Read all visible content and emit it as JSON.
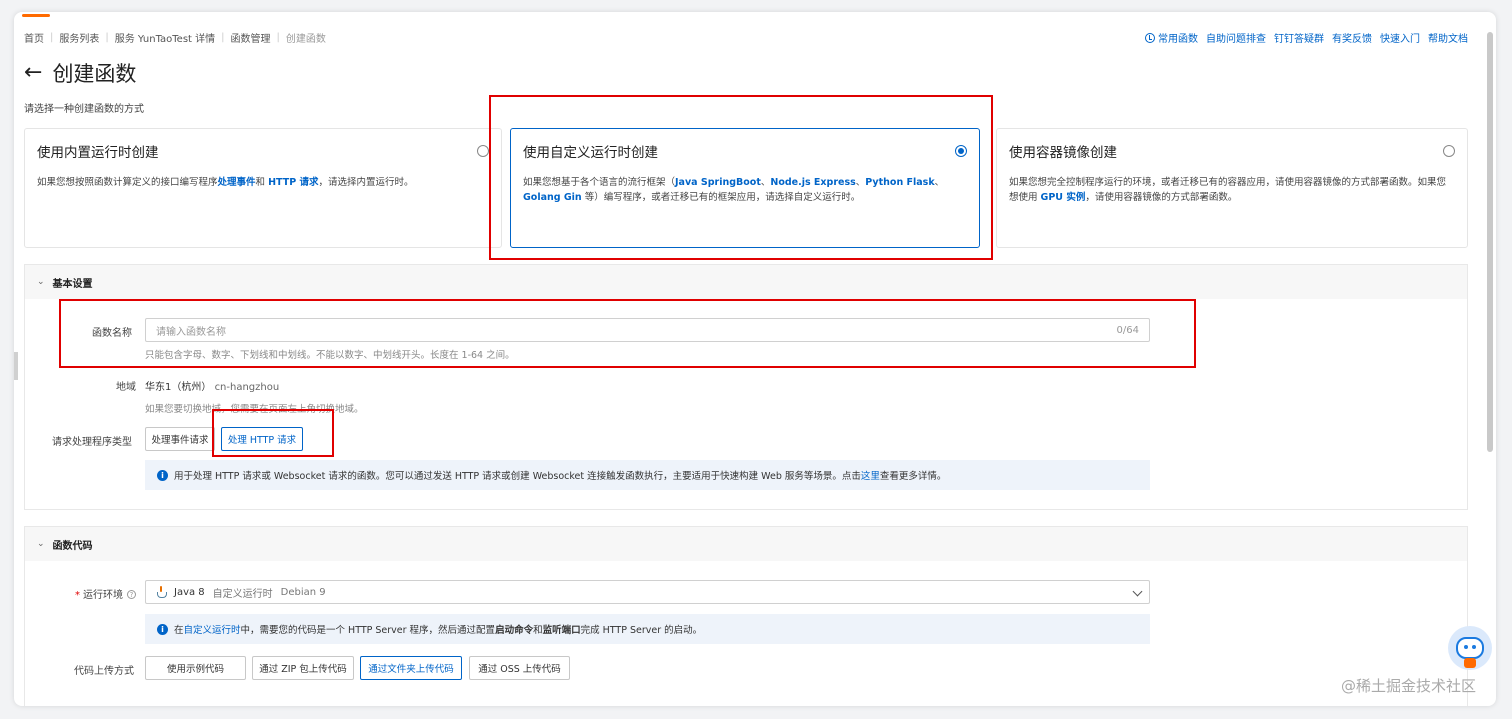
{
  "breadcrumb": {
    "items": [
      "首页",
      "服务列表",
      "服务 YunTaoTest 详情",
      "函数管理"
    ],
    "current": "创建函数"
  },
  "toplinks": [
    "常用函数",
    "自助问题排查",
    "钉钉答疑群",
    "有奖反馈",
    "快速入门",
    "帮助文档"
  ],
  "page": {
    "title": "创建函数",
    "subtitle": "请选择一种创建函数的方式"
  },
  "cards": [
    {
      "title": "使用内置运行时创建",
      "desc_pre": "如果您想按照函数计算定义的接口编写程序",
      "desc_b1": "处理事件",
      "desc_mid": "和 ",
      "desc_b2": "HTTP 请求",
      "desc_post": "，请选择内置运行时。",
      "selected": false
    },
    {
      "title": "使用自定义运行时创建",
      "desc_pre": "如果您想基于各个语言的流行框架（",
      "desc_b1": "Java SpringBoot",
      "desc_s1": "、",
      "desc_b2": "Node.js Express",
      "desc_s2": "、",
      "desc_b3": "Python Flask",
      "desc_s3": "、",
      "desc_b4": "Golang Gin",
      "desc_post": " 等）编写程序，或者迁移已有的框架应用，请选择自定义运行时。",
      "selected": true
    },
    {
      "title": "使用容器镜像创建",
      "desc_pre": "如果您想完全控制程序运行的环境，或者迁移已有的容器应用，请使用容器镜像的方式部署函数。如果您想使用 ",
      "desc_b1": "GPU 实例",
      "desc_post": "，请使用容器镜像的方式部署函数。",
      "selected": false
    }
  ],
  "basic": {
    "section_title": "基本设置",
    "name_label": "函数名称",
    "name_placeholder": "请输入函数名称",
    "name_counter": "0/64",
    "name_hint": "只能包含字母、数字、下划线和中划线。不能以数字、中划线开头。长度在 1-64 之间。",
    "region_label": "地域",
    "region_value": "华东1（杭州）",
    "region_code": "cn-hangzhou",
    "region_hint": "如果您要切换地域，您需要在页面左上角切换地域。",
    "handler_label": "请求处理程序类型",
    "handler_options": [
      "处理事件请求",
      "处理 HTTP 请求"
    ],
    "handler_info_pre": "用于处理 HTTP 请求或 Websocket 请求的函数。您可以通过发送 HTTP 请求或创建 Websocket 连接触发函数执行，主要适用于快速构建 Web 服务等场景。点击",
    "handler_info_link": "这里",
    "handler_info_post": "查看更多详情。"
  },
  "code": {
    "section_title": "函数代码",
    "runtime_label": "运行环境",
    "runtime_value": "Java 8",
    "runtime_type": "自定义运行时",
    "runtime_os": "Debian 9",
    "runtime_info_pre": "在",
    "runtime_info_link": "自定义运行时",
    "runtime_info_mid": "中，需要您的代码是一个 HTTP Server 程序，然后通过配置",
    "runtime_info_b1": "启动命令",
    "runtime_info_and": "和",
    "runtime_info_b2": "监听端口",
    "runtime_info_post": "完成 HTTP Server 的启动。",
    "upload_label": "代码上传方式",
    "upload_options": [
      "使用示例代码",
      "通过 ZIP 包上传代码",
      "通过文件夹上传代码",
      "通过 OSS 上传代码"
    ],
    "upload_selected": 2
  },
  "watermark": "@稀土掘金技术社区",
  "icons": {
    "back": "back-arrow-icon",
    "clock": "clock-icon",
    "info": "info-icon",
    "java": "java-icon"
  },
  "colors": {
    "accent": "#0064c8",
    "highlight": "#e00000",
    "brand": "#ff6a00"
  }
}
